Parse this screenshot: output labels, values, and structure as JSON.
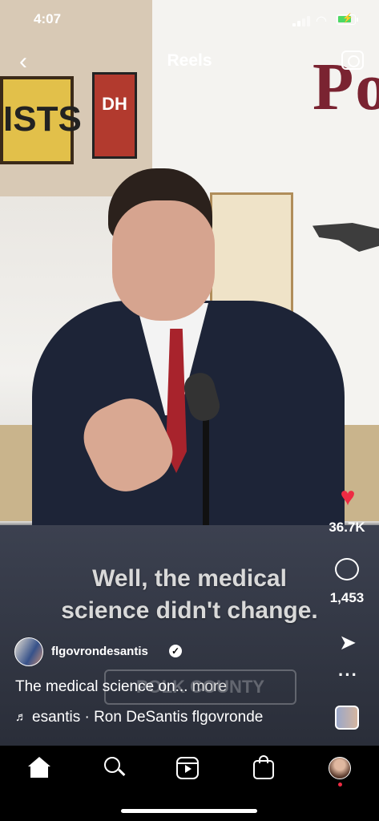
{
  "status_bar": {
    "time": "4:07"
  },
  "header": {
    "title": "Reels"
  },
  "video": {
    "overlay_caption_line1": "Well, the medical",
    "overlay_caption_line2": "science didn't change.",
    "background_sign_left": "ISTS",
    "background_sign_dh": "DH",
    "background_letters": "Po",
    "podium_sign": "POLK COUNTY"
  },
  "actions": {
    "like_count": "36.7K",
    "comment_count": "1,453",
    "icons": [
      "heart-icon",
      "comment-icon",
      "send-icon",
      "more-icon"
    ]
  },
  "post": {
    "username": "flgovrondesantis",
    "caption": "The medical science on...",
    "caption_more": " more",
    "audio": "esantis · Ron DeSantis  flgovronde"
  },
  "tabbar": {
    "icons": [
      "home-icon",
      "search-icon",
      "reels-icon",
      "shop-icon",
      "profile-icon"
    ]
  },
  "colors": {
    "like": "#ee2b43",
    "background": "#000000"
  }
}
